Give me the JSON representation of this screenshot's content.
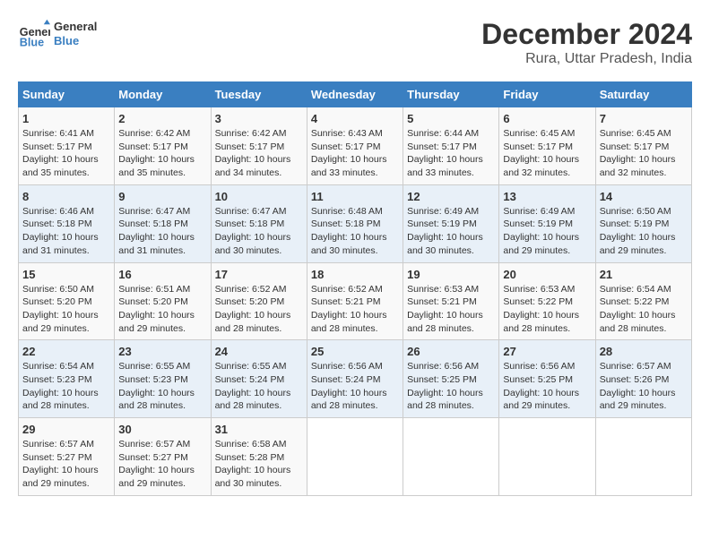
{
  "header": {
    "logo_line1": "General",
    "logo_line2": "Blue",
    "main_title": "December 2024",
    "subtitle": "Rura, Uttar Pradesh, India"
  },
  "calendar": {
    "weekdays": [
      "Sunday",
      "Monday",
      "Tuesday",
      "Wednesday",
      "Thursday",
      "Friday",
      "Saturday"
    ],
    "weeks": [
      [
        null,
        {
          "day": "2",
          "sunrise": "6:42 AM",
          "sunset": "5:17 PM",
          "daylight": "10 hours and 35 minutes."
        },
        {
          "day": "3",
          "sunrise": "6:42 AM",
          "sunset": "5:17 PM",
          "daylight": "10 hours and 34 minutes."
        },
        {
          "day": "4",
          "sunrise": "6:43 AM",
          "sunset": "5:17 PM",
          "daylight": "10 hours and 33 minutes."
        },
        {
          "day": "5",
          "sunrise": "6:44 AM",
          "sunset": "5:17 PM",
          "daylight": "10 hours and 33 minutes."
        },
        {
          "day": "6",
          "sunrise": "6:45 AM",
          "sunset": "5:17 PM",
          "daylight": "10 hours and 32 minutes."
        },
        {
          "day": "7",
          "sunrise": "6:45 AM",
          "sunset": "5:17 PM",
          "daylight": "10 hours and 32 minutes."
        }
      ],
      [
        {
          "day": "1",
          "sunrise": "6:41 AM",
          "sunset": "5:17 PM",
          "daylight": "10 hours and 35 minutes."
        },
        null,
        null,
        null,
        null,
        null,
        null
      ],
      [
        {
          "day": "8",
          "sunrise": "6:46 AM",
          "sunset": "5:18 PM",
          "daylight": "10 hours and 31 minutes."
        },
        {
          "day": "9",
          "sunrise": "6:47 AM",
          "sunset": "5:18 PM",
          "daylight": "10 hours and 31 minutes."
        },
        {
          "day": "10",
          "sunrise": "6:47 AM",
          "sunset": "5:18 PM",
          "daylight": "10 hours and 30 minutes."
        },
        {
          "day": "11",
          "sunrise": "6:48 AM",
          "sunset": "5:18 PM",
          "daylight": "10 hours and 30 minutes."
        },
        {
          "day": "12",
          "sunrise": "6:49 AM",
          "sunset": "5:19 PM",
          "daylight": "10 hours and 30 minutes."
        },
        {
          "day": "13",
          "sunrise": "6:49 AM",
          "sunset": "5:19 PM",
          "daylight": "10 hours and 29 minutes."
        },
        {
          "day": "14",
          "sunrise": "6:50 AM",
          "sunset": "5:19 PM",
          "daylight": "10 hours and 29 minutes."
        }
      ],
      [
        {
          "day": "15",
          "sunrise": "6:50 AM",
          "sunset": "5:20 PM",
          "daylight": "10 hours and 29 minutes."
        },
        {
          "day": "16",
          "sunrise": "6:51 AM",
          "sunset": "5:20 PM",
          "daylight": "10 hours and 29 minutes."
        },
        {
          "day": "17",
          "sunrise": "6:52 AM",
          "sunset": "5:20 PM",
          "daylight": "10 hours and 28 minutes."
        },
        {
          "day": "18",
          "sunrise": "6:52 AM",
          "sunset": "5:21 PM",
          "daylight": "10 hours and 28 minutes."
        },
        {
          "day": "19",
          "sunrise": "6:53 AM",
          "sunset": "5:21 PM",
          "daylight": "10 hours and 28 minutes."
        },
        {
          "day": "20",
          "sunrise": "6:53 AM",
          "sunset": "5:22 PM",
          "daylight": "10 hours and 28 minutes."
        },
        {
          "day": "21",
          "sunrise": "6:54 AM",
          "sunset": "5:22 PM",
          "daylight": "10 hours and 28 minutes."
        }
      ],
      [
        {
          "day": "22",
          "sunrise": "6:54 AM",
          "sunset": "5:23 PM",
          "daylight": "10 hours and 28 minutes."
        },
        {
          "day": "23",
          "sunrise": "6:55 AM",
          "sunset": "5:23 PM",
          "daylight": "10 hours and 28 minutes."
        },
        {
          "day": "24",
          "sunrise": "6:55 AM",
          "sunset": "5:24 PM",
          "daylight": "10 hours and 28 minutes."
        },
        {
          "day": "25",
          "sunrise": "6:56 AM",
          "sunset": "5:24 PM",
          "daylight": "10 hours and 28 minutes."
        },
        {
          "day": "26",
          "sunrise": "6:56 AM",
          "sunset": "5:25 PM",
          "daylight": "10 hours and 28 minutes."
        },
        {
          "day": "27",
          "sunrise": "6:56 AM",
          "sunset": "5:25 PM",
          "daylight": "10 hours and 29 minutes."
        },
        {
          "day": "28",
          "sunrise": "6:57 AM",
          "sunset": "5:26 PM",
          "daylight": "10 hours and 29 minutes."
        }
      ],
      [
        {
          "day": "29",
          "sunrise": "6:57 AM",
          "sunset": "5:27 PM",
          "daylight": "10 hours and 29 minutes."
        },
        {
          "day": "30",
          "sunrise": "6:57 AM",
          "sunset": "5:27 PM",
          "daylight": "10 hours and 29 minutes."
        },
        {
          "day": "31",
          "sunrise": "6:58 AM",
          "sunset": "5:28 PM",
          "daylight": "10 hours and 30 minutes."
        },
        null,
        null,
        null,
        null
      ]
    ]
  }
}
